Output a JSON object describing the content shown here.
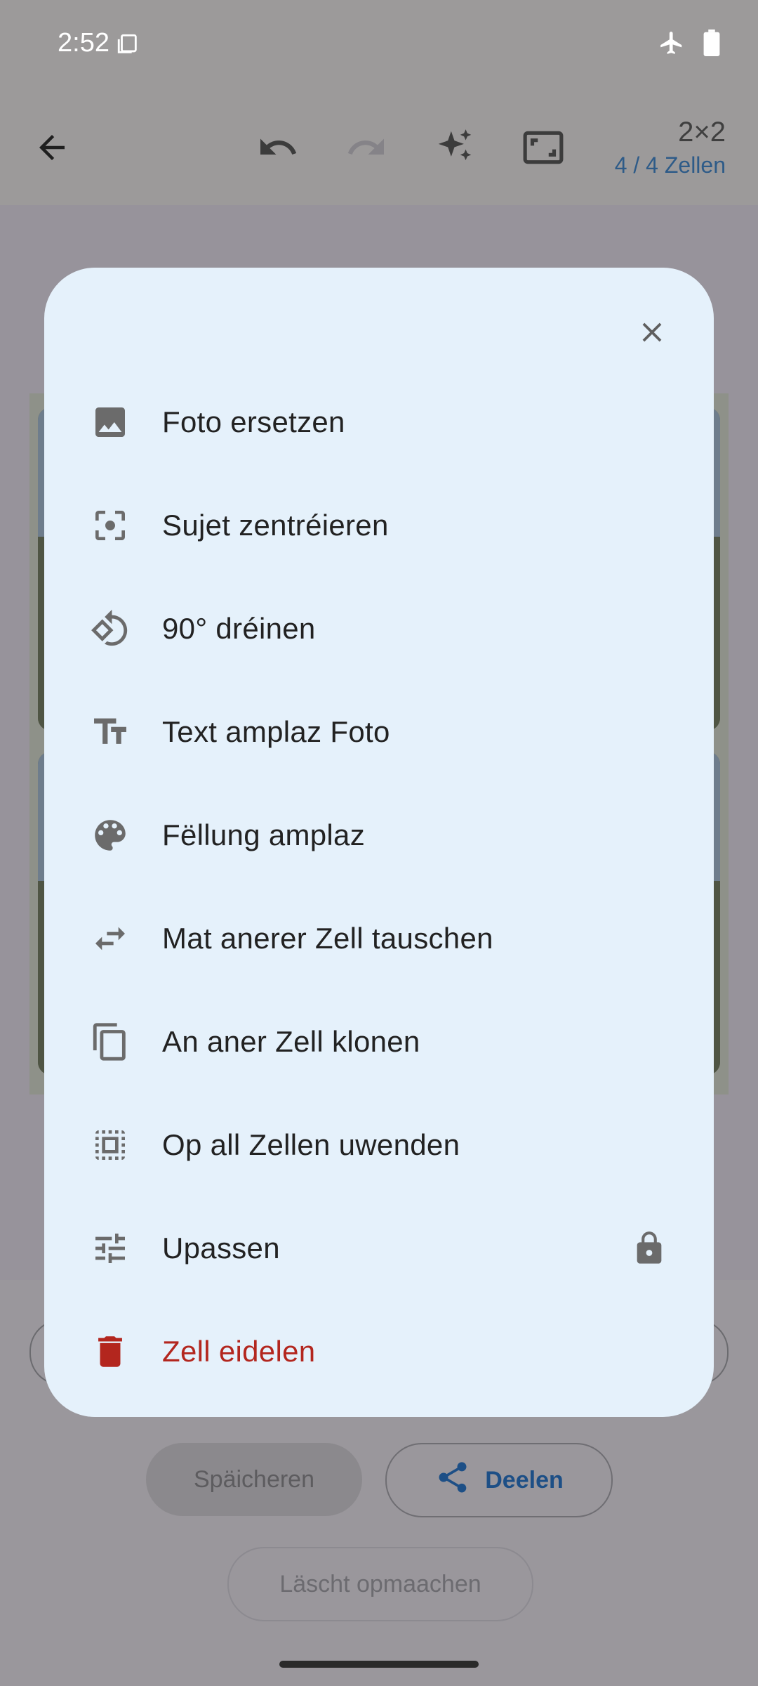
{
  "status_bar": {
    "time": "2:52"
  },
  "toolbar": {
    "grid_size": "2×2",
    "cells_status": "4 / 4 Zellen"
  },
  "bottom": {
    "save_label": "Späicheren",
    "share_label": "Deelen",
    "clear_label": "Läscht opmaachen"
  },
  "dialog": {
    "items": [
      {
        "label": "Foto ersetzen",
        "icon": "image-icon"
      },
      {
        "label": "Sujet zentréieren",
        "icon": "center-focus-icon"
      },
      {
        "label": "90° dréinen",
        "icon": "rotate-icon"
      },
      {
        "label": "Text amplaz Foto",
        "icon": "text-fields-icon"
      },
      {
        "label": "Fëllung amplaz",
        "icon": "palette-icon"
      },
      {
        "label": "Mat anerer Zell tauschen",
        "icon": "swap-icon"
      },
      {
        "label": "An aner Zell klonen",
        "icon": "copy-icon"
      },
      {
        "label": "Op all Zellen uwenden",
        "icon": "select-all-icon"
      },
      {
        "label": "Upassen",
        "icon": "tune-icon",
        "locked": true
      },
      {
        "label": "Zell eidelen",
        "icon": "delete-icon",
        "danger": true
      }
    ]
  },
  "colors": {
    "sheet_bg": "#e5f1fb",
    "danger": "#b3261e",
    "accent": "#1d4f86",
    "icon_gray": "#6e6e6e"
  }
}
